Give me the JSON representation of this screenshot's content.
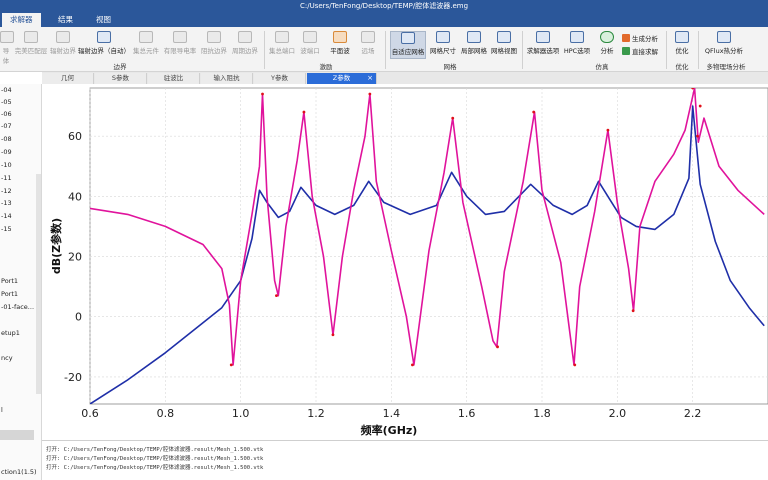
{
  "window": {
    "title": "C:/Users/TenFong/Desktop/TEMP/腔体滤波器.emg"
  },
  "menu": {
    "tabs": [
      {
        "label": "求解器",
        "active": true
      },
      {
        "label": "结果",
        "active": false
      },
      {
        "label": "视图",
        "active": false
      }
    ]
  },
  "ribbon": {
    "boundary": {
      "items": [
        "导体",
        "完美匹配层",
        "辐射边界",
        "辐射边界（自动）",
        "集总元件",
        "有限导电率",
        "阻抗边界",
        "周期边界"
      ],
      "group": "边界"
    },
    "excitation": {
      "items": [
        "集总端口",
        "波端口",
        "平面波",
        "远场"
      ],
      "group": "激励"
    },
    "mesh": {
      "items": [
        "自适应网格",
        "网格尺寸",
        "局部网格",
        "网格视图"
      ],
      "group": "网格"
    },
    "simulation": {
      "items": [
        "求解器选项",
        "HPC选项",
        "分析"
      ],
      "small": [
        "生成分析",
        "直接求解"
      ],
      "group": "仿真"
    },
    "optimize": {
      "label": "优化",
      "group": "优化"
    },
    "multiphysics": {
      "label": "QFlux热分析",
      "group": "多物理场分析"
    }
  },
  "doc_tabs": [
    {
      "label": "几何",
      "active": false
    },
    {
      "label": "S参数",
      "active": false
    },
    {
      "label": "驻波比",
      "active": false
    },
    {
      "label": "输入阻抗",
      "active": false
    },
    {
      "label": "Y参数",
      "active": false
    },
    {
      "label": "Z参数",
      "active": true
    }
  ],
  "sidebar": {
    "items": [
      "-04",
      "-05",
      "-06",
      "-07",
      "-08",
      "-09",
      "-10",
      "-11",
      "-12",
      "-13",
      "-14",
      "-15",
      "Port1",
      "Port1",
      "-01-face...",
      "etup1",
      "ncy",
      "l",
      "ction1(1.5)"
    ]
  },
  "console": {
    "lines": [
      "打开: C:/Users/TenFong/Desktop/TEMP/腔体滤波器.result/Mesh_1.500.vtk",
      "打开: C:/Users/TenFong/Desktop/TEMP/腔体滤波器.result/Mesh_1.500.vtk",
      "打开: C:/Users/TenFong/Desktop/TEMP/腔体滤波器.result/Mesh_1.500.vtk"
    ]
  },
  "chart_data": {
    "type": "line",
    "title": "",
    "xlabel": "频率(GHz)",
    "ylabel": "dB(Z参数)",
    "xlim": [
      0.6,
      2.4
    ],
    "ylim": [
      -29,
      76
    ],
    "xticks": [
      0.6,
      0.8,
      1.0,
      1.2,
      1.4,
      1.6,
      1.8,
      2.0,
      2.2
    ],
    "yticks": [
      -20,
      0,
      20,
      40,
      60
    ],
    "grid": true,
    "series": [
      {
        "color": "#1f2fa8",
        "x": [
          0.6,
          0.7,
          0.8,
          0.9,
          0.95,
          1.0,
          1.03,
          1.05,
          1.07,
          1.1,
          1.13,
          1.16,
          1.2,
          1.25,
          1.3,
          1.34,
          1.38,
          1.45,
          1.52,
          1.56,
          1.6,
          1.65,
          1.7,
          1.77,
          1.83,
          1.88,
          1.92,
          1.95,
          1.98,
          2.01,
          2.05,
          2.1,
          2.15,
          2.19,
          2.2,
          2.22,
          2.26,
          2.3,
          2.35,
          2.39
        ],
        "y": [
          -29,
          -21,
          -12,
          -2,
          3,
          12,
          26,
          42,
          38,
          33,
          35,
          43,
          37,
          34,
          37,
          45,
          38,
          34,
          37,
          48,
          40,
          34,
          35,
          44,
          37,
          34,
          37,
          45,
          39,
          33,
          30,
          29,
          34,
          46,
          70,
          44,
          25,
          12,
          3,
          -3
        ]
      },
      {
        "color": "#e0139c",
        "x": [
          0.6,
          0.7,
          0.8,
          0.9,
          0.95,
          0.97,
          0.98,
          1.0,
          1.03,
          1.05,
          1.058,
          1.07,
          1.09,
          1.1,
          1.12,
          1.15,
          1.168,
          1.19,
          1.22,
          1.245,
          1.27,
          1.3,
          1.33,
          1.343,
          1.36,
          1.4,
          1.44,
          1.46,
          1.5,
          1.54,
          1.563,
          1.59,
          1.64,
          1.67,
          1.68,
          1.7,
          1.75,
          1.78,
          1.8,
          1.85,
          1.885,
          1.9,
          1.94,
          1.975,
          2.0,
          2.03,
          2.043,
          2.06,
          2.1,
          2.15,
          2.18,
          2.205,
          2.215,
          2.23,
          2.27,
          2.32,
          2.39
        ],
        "y": [
          36,
          34,
          30,
          24,
          16,
          4,
          -16,
          12,
          34,
          50,
          74,
          40,
          12,
          7,
          30,
          52,
          68,
          40,
          20,
          -6,
          20,
          42,
          60,
          74,
          45,
          22,
          0,
          -16,
          22,
          48,
          66,
          38,
          10,
          -8,
          -10,
          15,
          45,
          68,
          42,
          18,
          -16,
          10,
          35,
          62,
          38,
          16,
          2,
          30,
          45,
          54,
          62,
          76,
          58,
          66,
          50,
          42,
          34
        ]
      }
    ],
    "markers": {
      "color": "#e0101a",
      "x": [
        0.975,
        1.058,
        1.095,
        1.168,
        1.245,
        1.343,
        1.456,
        1.563,
        1.682,
        1.778,
        1.887,
        1.975,
        2.042,
        2.2,
        2.213,
        2.22
      ],
      "y": [
        -16,
        74,
        7,
        68,
        -6,
        74,
        -16,
        66,
        -10,
        68,
        -16,
        62,
        2,
        76,
        60,
        70
      ]
    }
  }
}
